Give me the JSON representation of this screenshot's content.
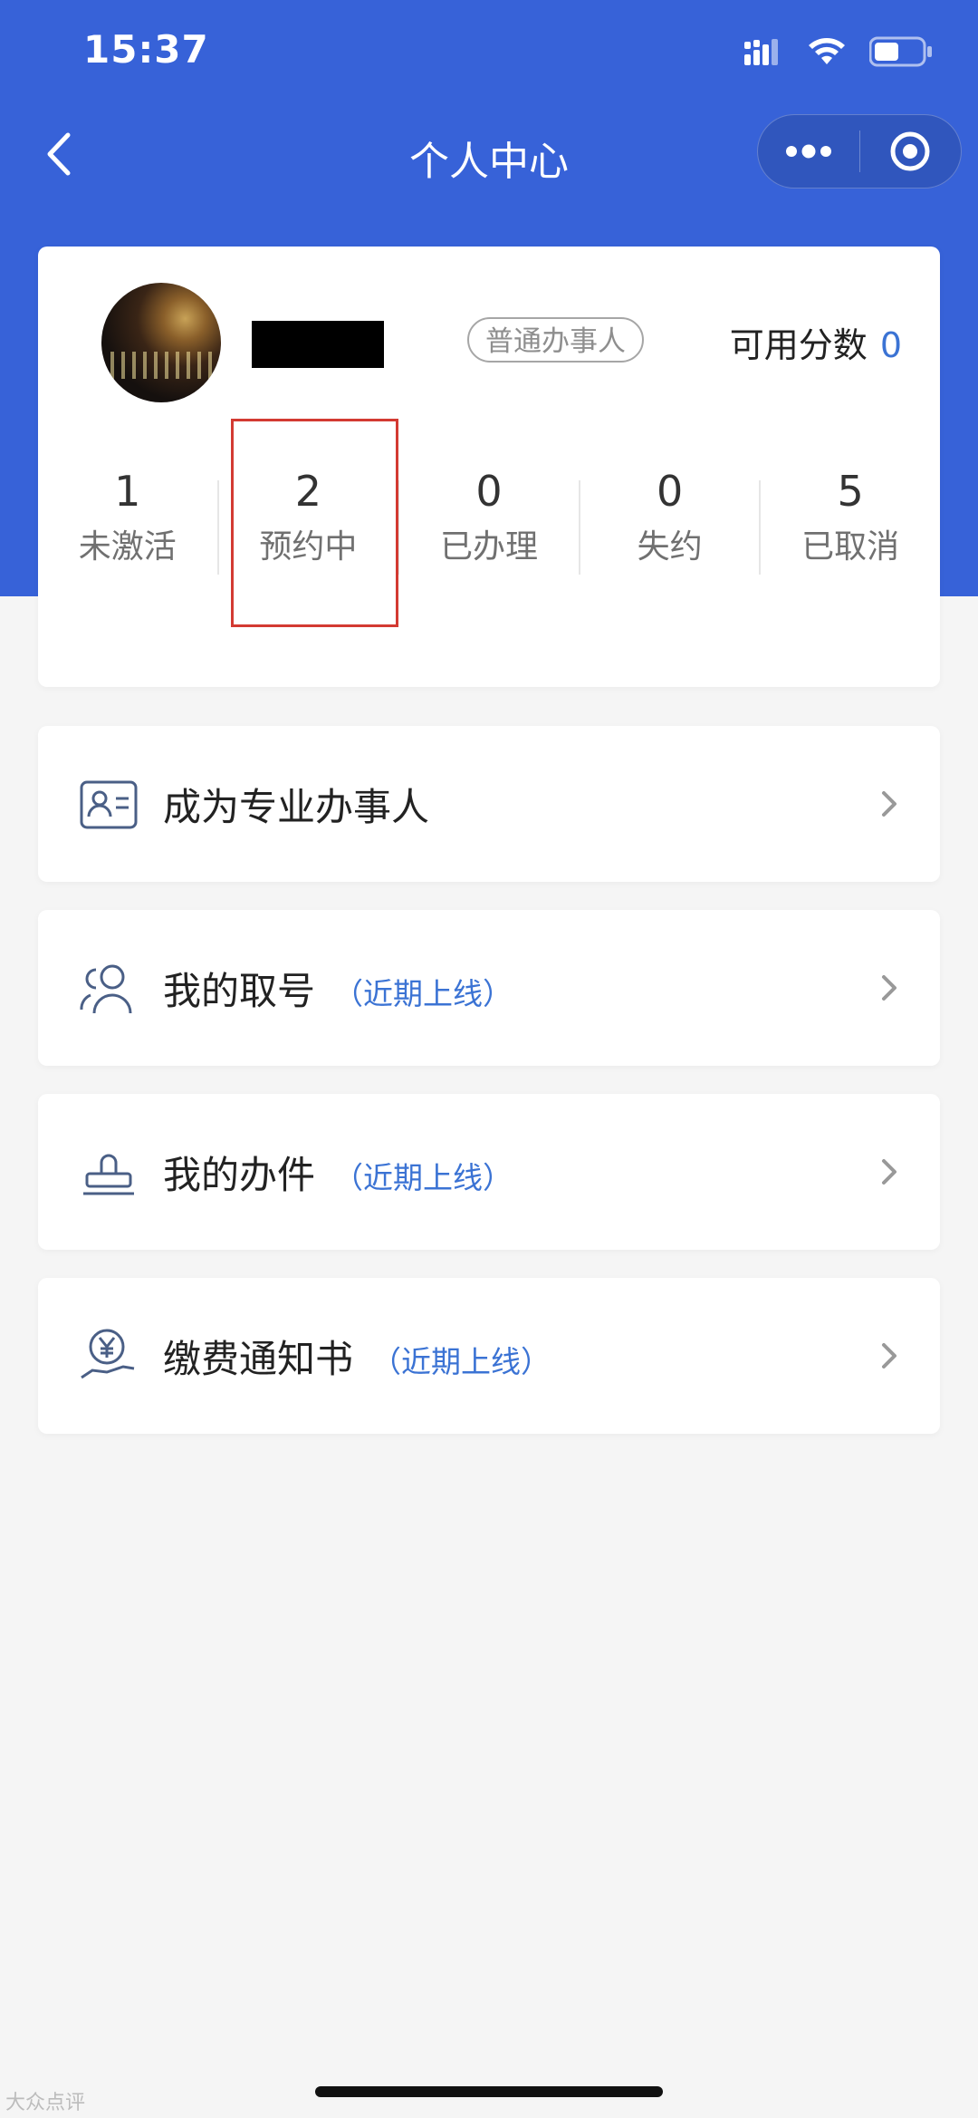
{
  "status_bar": {
    "time": "15:37"
  },
  "navbar": {
    "title": "个人中心"
  },
  "profile": {
    "badge": "普通办事人",
    "points_label": "可用分数",
    "points_value": "0"
  },
  "stats": [
    {
      "value": "1",
      "label": "未激活"
    },
    {
      "value": "2",
      "label": "预约中"
    },
    {
      "value": "0",
      "label": "已办理"
    },
    {
      "value": "0",
      "label": "失约"
    },
    {
      "value": "5",
      "label": "已取消"
    }
  ],
  "menu": [
    {
      "label": "成为专业办事人",
      "note": "",
      "icon": "id-card-icon"
    },
    {
      "label": "我的取号",
      "note": "（近期上线）",
      "icon": "users-icon"
    },
    {
      "label": "我的办件",
      "note": "（近期上线）",
      "icon": "stamp-icon"
    },
    {
      "label": "缴费通知书",
      "note": "（近期上线）",
      "icon": "payment-hand-icon"
    }
  ],
  "watermark": "大众点评",
  "colors": {
    "primary": "#3762d8",
    "accent": "#3b73d4",
    "highlight": "#d33a32"
  }
}
